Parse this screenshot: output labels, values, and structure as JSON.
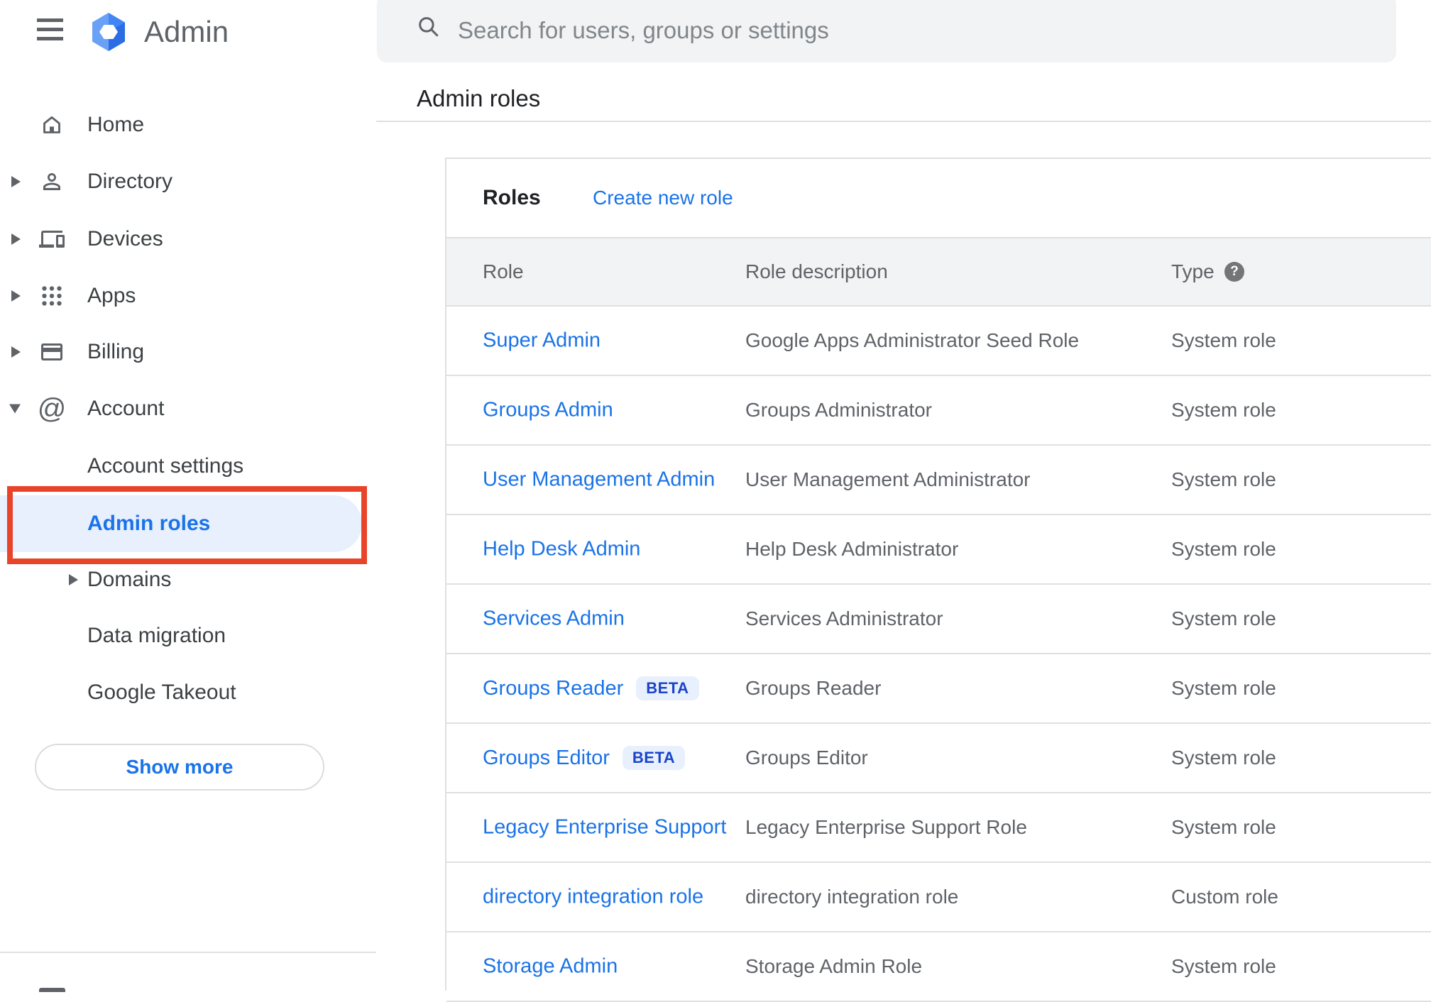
{
  "topbar": {
    "app_name": "Admin"
  },
  "search": {
    "placeholder": "Search for users, groups or settings"
  },
  "page": {
    "title": "Admin roles"
  },
  "sidebar": {
    "items": [
      {
        "label": "Home",
        "icon": "home-icon",
        "expandable": false
      },
      {
        "label": "Directory",
        "icon": "person-icon",
        "expandable": true
      },
      {
        "label": "Devices",
        "icon": "devices-icon",
        "expandable": true
      },
      {
        "label": "Apps",
        "icon": "apps-grid-icon",
        "expandable": true
      },
      {
        "label": "Billing",
        "icon": "credit-card-icon",
        "expandable": true
      },
      {
        "label": "Account",
        "icon": "at-sign-icon",
        "expandable": true,
        "expanded": true
      }
    ],
    "account_children": [
      {
        "label": "Account settings",
        "selected": false
      },
      {
        "label": "Admin roles",
        "selected": true,
        "annotated": true
      },
      {
        "label": "Domains",
        "selected": false,
        "expandable": true
      },
      {
        "label": "Data migration",
        "selected": false
      },
      {
        "label": "Google Takeout",
        "selected": false
      }
    ],
    "show_more_label": "Show more"
  },
  "roles_panel": {
    "heading": "Roles",
    "create_link": "Create new role",
    "beta_label": "BETA",
    "columns": [
      "Role",
      "Role description",
      "Type"
    ],
    "rows": [
      {
        "role": "Super Admin",
        "beta": false,
        "description": "Google Apps Administrator Seed Role",
        "type": "System role"
      },
      {
        "role": "Groups Admin",
        "beta": false,
        "description": "Groups Administrator",
        "type": "System role"
      },
      {
        "role": "User Management Admin",
        "beta": false,
        "description": "User Management Administrator",
        "type": "System role"
      },
      {
        "role": "Help Desk Admin",
        "beta": false,
        "description": "Help Desk Administrator",
        "type": "System role"
      },
      {
        "role": "Services Admin",
        "beta": false,
        "description": "Services Administrator",
        "type": "System role"
      },
      {
        "role": "Groups Reader",
        "beta": true,
        "description": "Groups Reader",
        "type": "System role"
      },
      {
        "role": "Groups Editor",
        "beta": true,
        "description": "Groups Editor",
        "type": "System role"
      },
      {
        "role": "Legacy Enterprise Support",
        "beta": false,
        "description": "Legacy Enterprise Support Role",
        "type": "System role"
      },
      {
        "role": "directory integration role",
        "beta": false,
        "description": "directory integration role",
        "type": "Custom role"
      },
      {
        "role": "Storage Admin",
        "beta": false,
        "description": "Storage Admin Role",
        "type": "System role"
      }
    ]
  },
  "colors": {
    "link_blue": "#1a73e8",
    "selected_bg": "#e8f0fe",
    "annotation_red": "#e8442a",
    "header_band": "#f1f3f4",
    "beta_text": "#1b44c8",
    "text_gray": "#5f6368",
    "divider": "#e0e0e0"
  }
}
